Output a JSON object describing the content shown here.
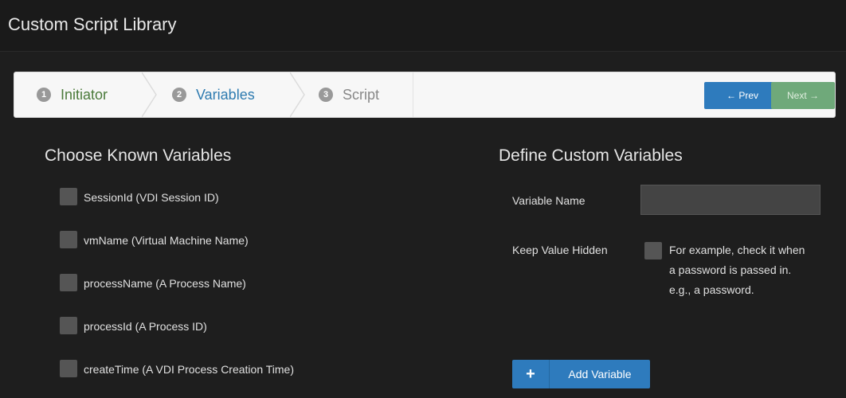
{
  "header": {
    "title": "Custom Script Library"
  },
  "wizard": {
    "steps": [
      {
        "num": "1",
        "label": "Initiator"
      },
      {
        "num": "2",
        "label": "Variables"
      },
      {
        "num": "3",
        "label": "Script"
      }
    ],
    "prev_label": "← Prev",
    "next_label": "Next →"
  },
  "known": {
    "title": "Choose Known Variables",
    "items": [
      "SessionId (VDI Session ID)",
      "vmName (Virtual Machine Name)",
      "processName (A Process Name)",
      "processId (A Process ID)",
      "createTime (A VDI Process Creation Time)"
    ]
  },
  "custom": {
    "title": "Define Custom Variables",
    "var_name_label": "Variable Name",
    "var_name_value": "",
    "hidden_label": "Keep Value Hidden",
    "hint": "For example, check it when a password is passed in. e.g., a password.",
    "add_icon": "+",
    "add_label": "Add Variable"
  }
}
